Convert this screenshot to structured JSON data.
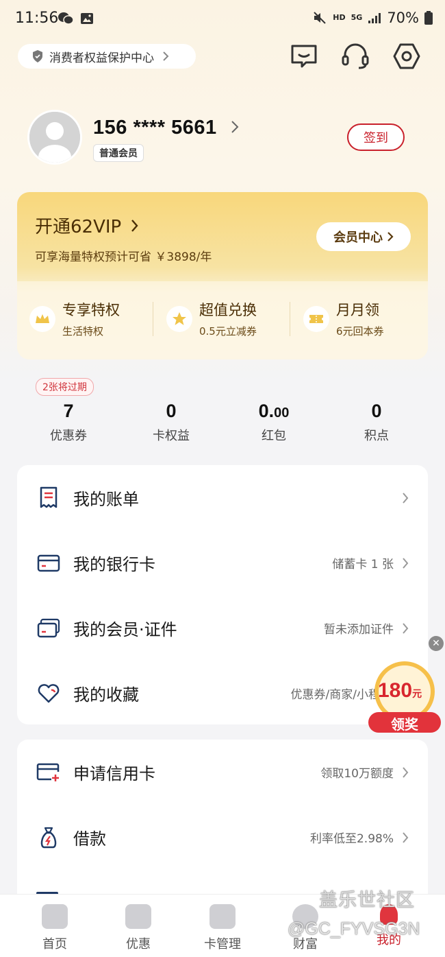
{
  "status_bar": {
    "time": "11:56",
    "network_hd": "HD",
    "network_5g": "5G",
    "battery": "70%"
  },
  "header": {
    "protection_center": "消费者权益保护中心"
  },
  "profile": {
    "phone": "156 **** 5661",
    "member_level": "普通会员",
    "signin_label": "签到"
  },
  "vip": {
    "title": "开通62VIP",
    "subtitle": "可享海量特权预计可省 ￥3898/年",
    "center_button": "会员中心",
    "perks": [
      {
        "title": "专享特权",
        "sub": "生活特权",
        "icon": "crown-icon"
      },
      {
        "title": "超值兑换",
        "sub": "0.5元立减券",
        "icon": "star-icon"
      },
      {
        "title": "月月领",
        "sub": "6元回本券",
        "icon": "ticket-icon"
      }
    ]
  },
  "stats": {
    "expire_badge": "2张将过期",
    "items": [
      {
        "value": "7",
        "label": "优惠券"
      },
      {
        "value": "0",
        "label": "卡权益"
      },
      {
        "value_int": "0.",
        "value_dec": "00",
        "label": "红包"
      },
      {
        "value": "0",
        "label": "积点"
      }
    ]
  },
  "menu1": {
    "rows": [
      {
        "label": "我的账单",
        "meta": ""
      },
      {
        "label": "我的银行卡",
        "meta": "储蓄卡 1 张"
      },
      {
        "label": "我的会员·证件",
        "meta": "暂未添加证件"
      },
      {
        "label": "我的收藏",
        "meta": "优惠券/商家/小程"
      }
    ]
  },
  "menu2": {
    "rows": [
      {
        "label": "申请信用卡",
        "meta": "领取10万额度"
      },
      {
        "label": "借款",
        "meta": "利率低至2.98%"
      }
    ]
  },
  "float_reward": {
    "amount": "180",
    "unit": "元",
    "action": "领奖"
  },
  "bottom_nav": {
    "items": [
      {
        "label": "首页"
      },
      {
        "label": "优惠"
      },
      {
        "label": "卡管理"
      },
      {
        "label": "财富"
      },
      {
        "label": "我的"
      }
    ]
  },
  "watermark": {
    "line1": "盖乐世社区",
    "line2": "@GC_FYVSG3N"
  },
  "colors": {
    "brand_red": "#c9202b",
    "vip_gold": "#f8d77b"
  }
}
